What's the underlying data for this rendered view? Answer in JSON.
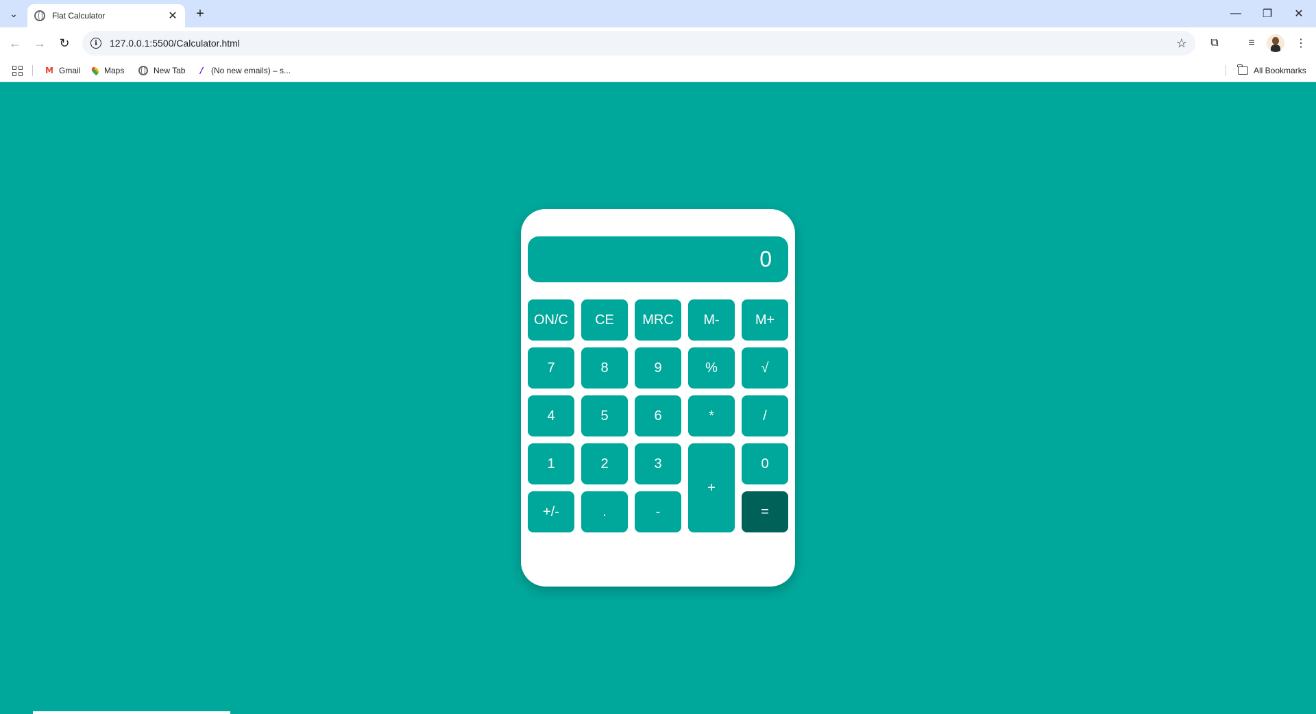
{
  "browser": {
    "tab": {
      "title": "Flat Calculator",
      "close": "✕"
    },
    "new_tab": "+",
    "tab_list": "⌄",
    "window": {
      "minimize": "—",
      "maximize": "❐",
      "close": "✕"
    },
    "nav": {
      "back": "←",
      "forward": "→",
      "reload": "↻"
    },
    "url": "127.0.0.1:5500/Calculator.html",
    "icons": {
      "star": "☆",
      "extensions": "⧉",
      "media": "≡",
      "menu": "⋮",
      "info": "i"
    },
    "bookmarks": [
      {
        "label": "Gmail",
        "icon": "gmail-icon",
        "glyph": "M"
      },
      {
        "label": "Maps",
        "icon": "maps-icon"
      },
      {
        "label": "New Tab",
        "icon": "globe-icon"
      },
      {
        "label": "(No new emails) – s...",
        "icon": "yahoo-icon",
        "glyph": "/"
      }
    ],
    "all_bookmarks": "All Bookmarks"
  },
  "calculator": {
    "display": "0",
    "keys": {
      "on_c": "ON/C",
      "ce": "CE",
      "mrc": "MRC",
      "m_minus": "M-",
      "m_plus": "M+",
      "k7": "7",
      "k8": "8",
      "k9": "9",
      "percent": "%",
      "sqrt": "√",
      "k4": "4",
      "k5": "5",
      "k6": "6",
      "multiply": "*",
      "divide": "/",
      "k1": "1",
      "k2": "2",
      "k3": "3",
      "plus": "+",
      "k0": "0",
      "sign": "+/-",
      "dot": ".",
      "minus": "-",
      "equals": "="
    },
    "colors": {
      "background": "#00a89c",
      "key": "#00a89c",
      "equals_key": "#006159",
      "body": "#ffffff"
    }
  }
}
